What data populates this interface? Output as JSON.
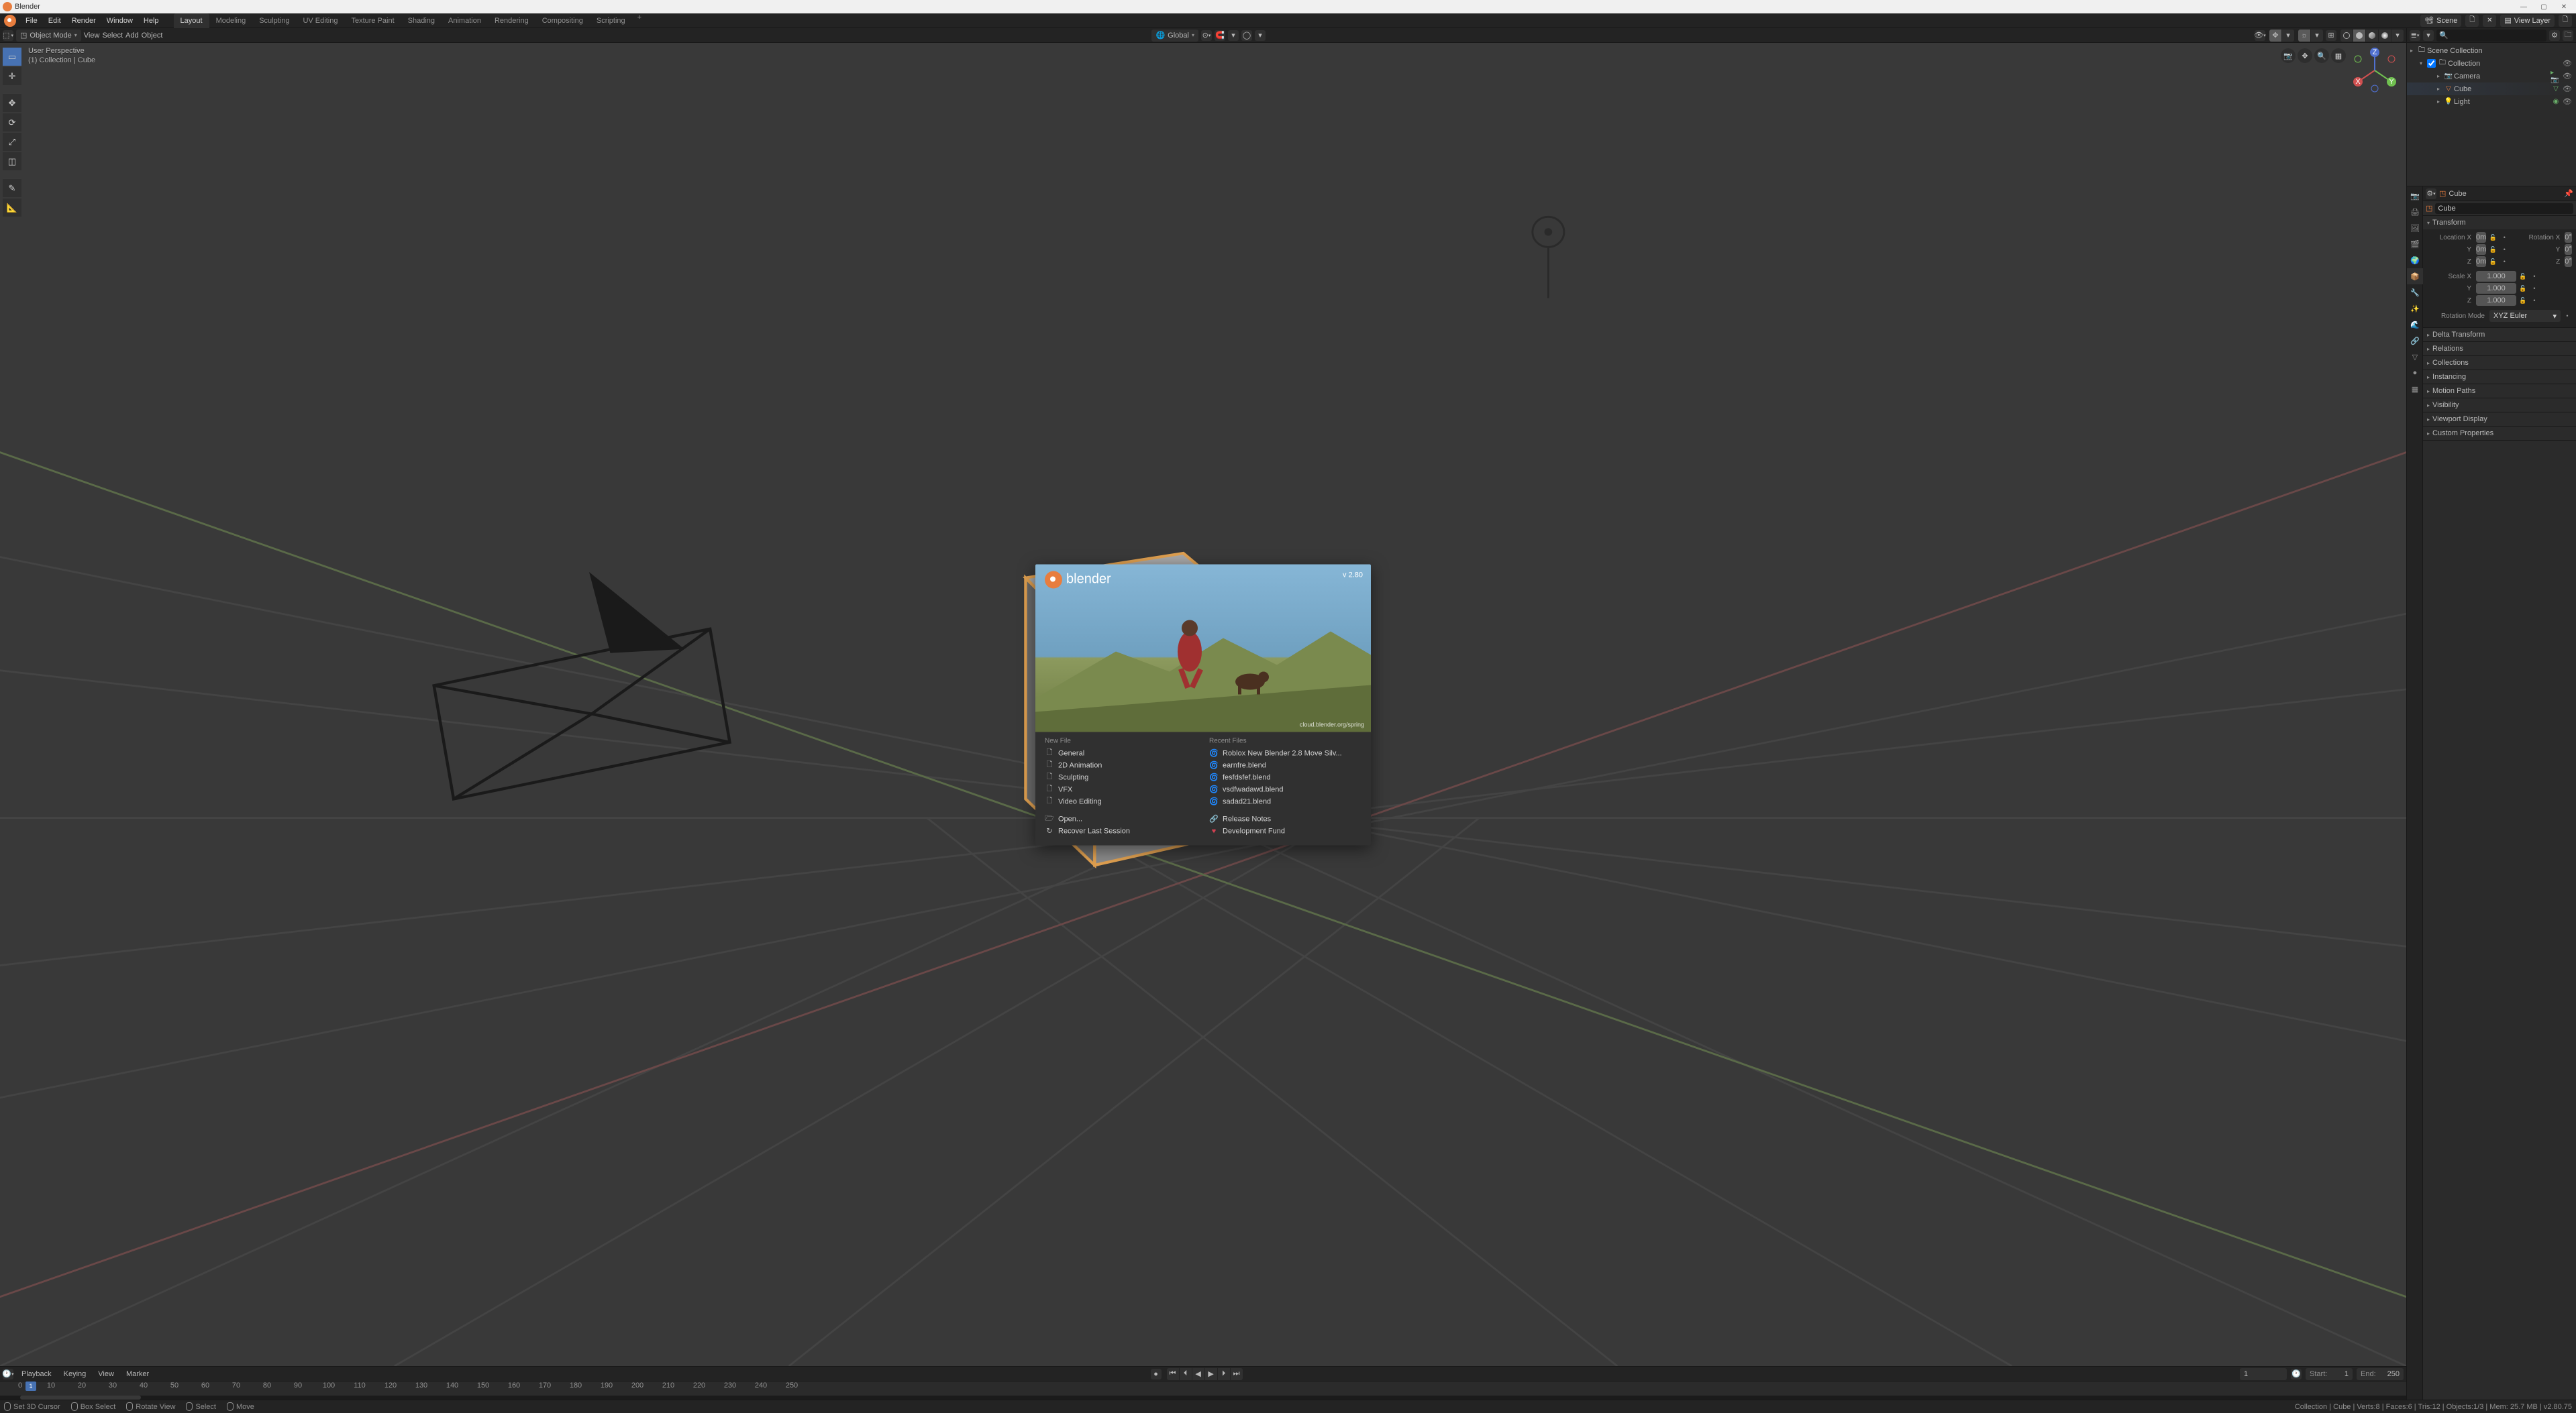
{
  "title": "Blender",
  "menu": [
    "File",
    "Edit",
    "Render",
    "Window",
    "Help"
  ],
  "workspaces": [
    "Layout",
    "Modeling",
    "Sculpting",
    "UV Editing",
    "Texture Paint",
    "Shading",
    "Animation",
    "Rendering",
    "Compositing",
    "Scripting"
  ],
  "active_workspace": "Layout",
  "scene_label": "Scene",
  "viewlayer_label": "View Layer",
  "viewport_header": {
    "mode": "Object Mode",
    "menus": [
      "View",
      "Select",
      "Add",
      "Object"
    ],
    "orientation": "Global"
  },
  "viewport_info": {
    "line1": "User Perspective",
    "line2": "(1) Collection | Cube"
  },
  "nav_axes": {
    "x": "X",
    "y": "Y",
    "z": "Z"
  },
  "splash": {
    "brand": "blender",
    "version": "v 2.80",
    "credit": "cloud.blender.org/spring",
    "new_file_header": "New File",
    "new_file": [
      "General",
      "2D Animation",
      "Sculpting",
      "VFX",
      "Video Editing"
    ],
    "open": "Open...",
    "recover": "Recover Last Session",
    "recent_header": "Recent Files",
    "recent": [
      "Roblox New Blender 2.8 Move Silv...",
      "earnfre.blend",
      "fesfdsfef.blend",
      "vsdfwadawd.blend",
      "sadad21.blend"
    ],
    "release_notes": "Release Notes",
    "dev_fund": "Development Fund"
  },
  "timeline": {
    "menus": [
      "Playback",
      "Keying",
      "View",
      "Marker"
    ],
    "current": 1,
    "start_label": "Start:",
    "start": 1,
    "end_label": "End:",
    "end": 250,
    "ticks": [
      0,
      10,
      20,
      30,
      40,
      50,
      60,
      70,
      80,
      90,
      100,
      110,
      120,
      130,
      140,
      150,
      160,
      170,
      180,
      190,
      200,
      210,
      220,
      230,
      240,
      250
    ]
  },
  "outliner": {
    "root": "Scene Collection",
    "collection": "Collection",
    "items": [
      {
        "name": "Camera",
        "type": "camera"
      },
      {
        "name": "Cube",
        "type": "mesh",
        "selected": true
      },
      {
        "name": "Light",
        "type": "light"
      }
    ]
  },
  "properties": {
    "context": "Cube",
    "name": "Cube",
    "transform": {
      "header": "Transform",
      "location_label": "Location X",
      "rotation_label": "Rotation X",
      "scale_label": "Scale X",
      "axes": [
        "Y",
        "Z"
      ],
      "loc": [
        "0m",
        "0m",
        "0m"
      ],
      "rot": [
        "0°",
        "0°",
        "0°"
      ],
      "scale": [
        "1.000",
        "1.000",
        "1.000"
      ],
      "rotmode_label": "Rotation Mode",
      "rotmode": "XYZ Euler"
    },
    "panels": [
      "Delta Transform",
      "Relations",
      "Collections",
      "Instancing",
      "Motion Paths",
      "Visibility",
      "Viewport Display",
      "Custom Properties"
    ]
  },
  "statusbar": {
    "left": [
      {
        "icon": "lmb",
        "text": "Set 3D Cursor"
      },
      {
        "icon": "lmb",
        "text": "Box Select"
      },
      {
        "icon": "mmb",
        "text": "Rotate View"
      },
      {
        "icon": "rmb",
        "text": "Select"
      },
      {
        "icon": "rmb",
        "text": "Move"
      }
    ],
    "right": "Collection | Cube | Verts:8 | Faces:6 | Tris:12 | Objects:1/3 | Mem: 25.7 MB | v2.80.75"
  }
}
